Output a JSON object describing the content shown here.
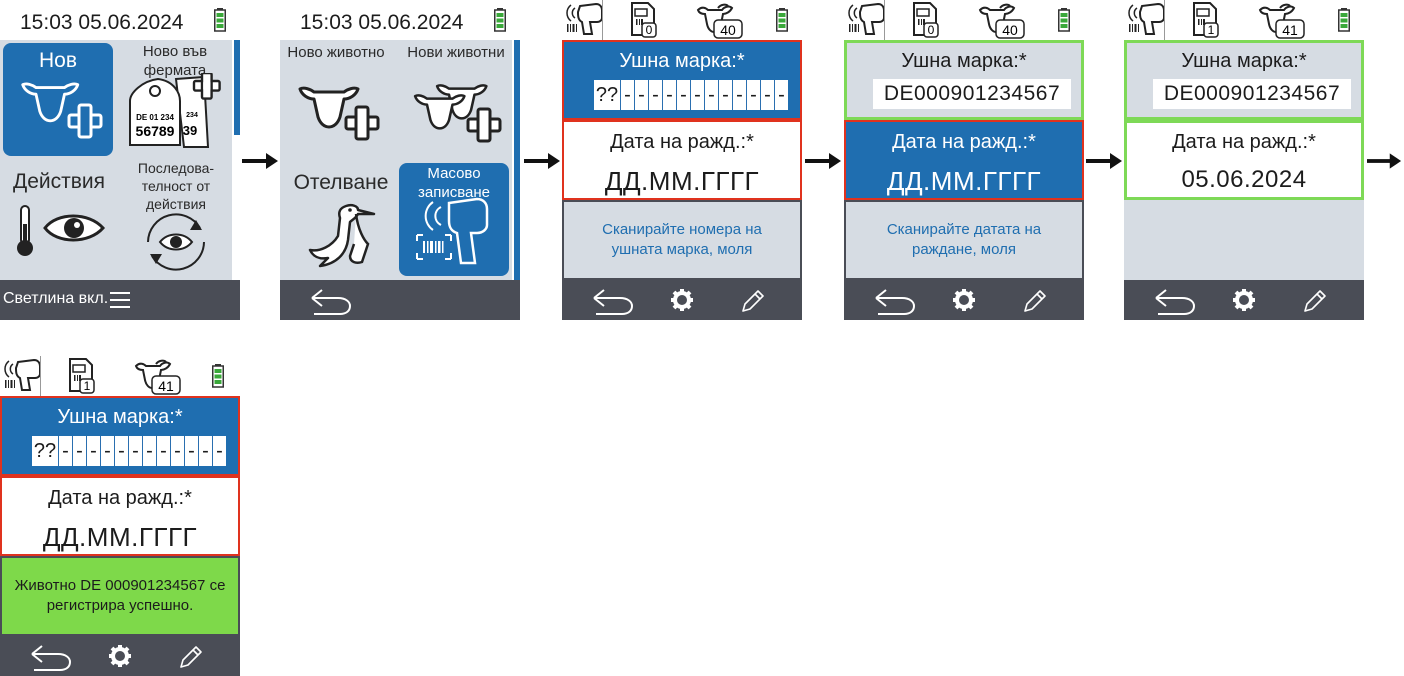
{
  "datetime": "15:03 05.06.2024",
  "colors": {
    "accent_blue": "#1f6eb0",
    "panel_grey": "#d6dce3",
    "bar_dark": "#4a4d56",
    "error_red": "#e0321e",
    "ok_green": "#7ed957",
    "success_bg": "#7ed94a",
    "battery": "#3aa83a"
  },
  "screen1": {
    "tiles": [
      {
        "label": "Нов",
        "icon": "cow-plus-icon"
      },
      {
        "label": "Ново във фермата",
        "icon": "ear-tag-plus-icon",
        "tag_text_1": "DE 01 234",
        "tag_text_2": "56789",
        "tag_text_3": "234",
        "tag_text_4": "39"
      },
      {
        "label": "Действия",
        "icon": "thermometer-eye-icon"
      },
      {
        "label": "Последова-телност от действия",
        "icon": "cycle-eye-icon"
      }
    ],
    "footer_label": "Светлина вкл.",
    "footer_icon": "menu-icon"
  },
  "screen2": {
    "tiles": [
      {
        "label": "Ново животно",
        "icon": "cow-plus-icon"
      },
      {
        "label": "Нови животни",
        "icon": "cows-plus-icon"
      },
      {
        "label": "Отелване",
        "icon": "stork-icon"
      },
      {
        "label": "Масово записване",
        "icon": "barcode-scanner-icon"
      }
    ],
    "footer_icon": "back-icon"
  },
  "steps": [
    {
      "scan_count": "0",
      "animal_count": "40",
      "ear_label": "Ушна марка:*",
      "ear_value": "??",
      "ear_filled": "",
      "birth_label": "Дата на ражд.:*",
      "birth_value": "ДД.ММ.ГГГГ",
      "message": "Сканирайте номера на ушната марка, моля"
    },
    {
      "scan_count": "0",
      "animal_count": "40",
      "ear_label": "Ушна марка:*",
      "ear_value": "",
      "ear_filled": "DE000901234567",
      "birth_label": "Дата на ражд.:*",
      "birth_value": "ДД.ММ.ГГГГ",
      "message": "Сканирайте датата на раждане, моля"
    },
    {
      "scan_count": "1",
      "animal_count": "41",
      "ear_label": "Ушна марка:*",
      "ear_value": "",
      "ear_filled": "DE000901234567",
      "birth_label": "Дата на ражд.:*",
      "birth_value": "05.06.2024",
      "message": ""
    },
    {
      "scan_count": "1",
      "animal_count": "41",
      "ear_label": "Ушна марка:*",
      "ear_value": "??",
      "ear_filled": "",
      "birth_label": "Дата на ражд.:*",
      "birth_value": "ДД.ММ.ГГГГ",
      "message": "Животно DE 000901234567 се регистрира успешно."
    }
  ],
  "footer_icons": [
    "back-icon",
    "gear-icon",
    "pencil-icon"
  ]
}
